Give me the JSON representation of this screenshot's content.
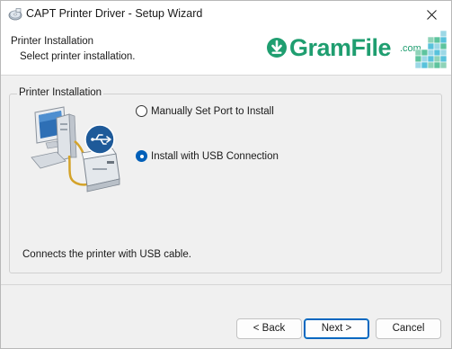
{
  "window": {
    "title": "CAPT Printer Driver - Setup Wizard"
  },
  "header": {
    "title": "Printer Installation",
    "subtitle": "Select printer installation.",
    "brand_text": "GramFile",
    "brand_suffix": ".com"
  },
  "group": {
    "title": "Printer Installation",
    "options": [
      {
        "label": "Manually Set Port to Install",
        "selected": false
      },
      {
        "label": "Install with USB Connection",
        "selected": true
      }
    ],
    "description": "Connects the printer with USB cable."
  },
  "buttons": {
    "back": "< Back",
    "next": "Next >",
    "cancel": "Cancel"
  },
  "colors": {
    "brand": "#1f9e70",
    "accent": "#005fb8",
    "usb_badge": "#1e5a99"
  },
  "icons": {
    "app": "printer-disc-icon",
    "close": "close-icon",
    "brand": "download-arrow-icon",
    "illustration": "computer-usb-printer-icon"
  }
}
